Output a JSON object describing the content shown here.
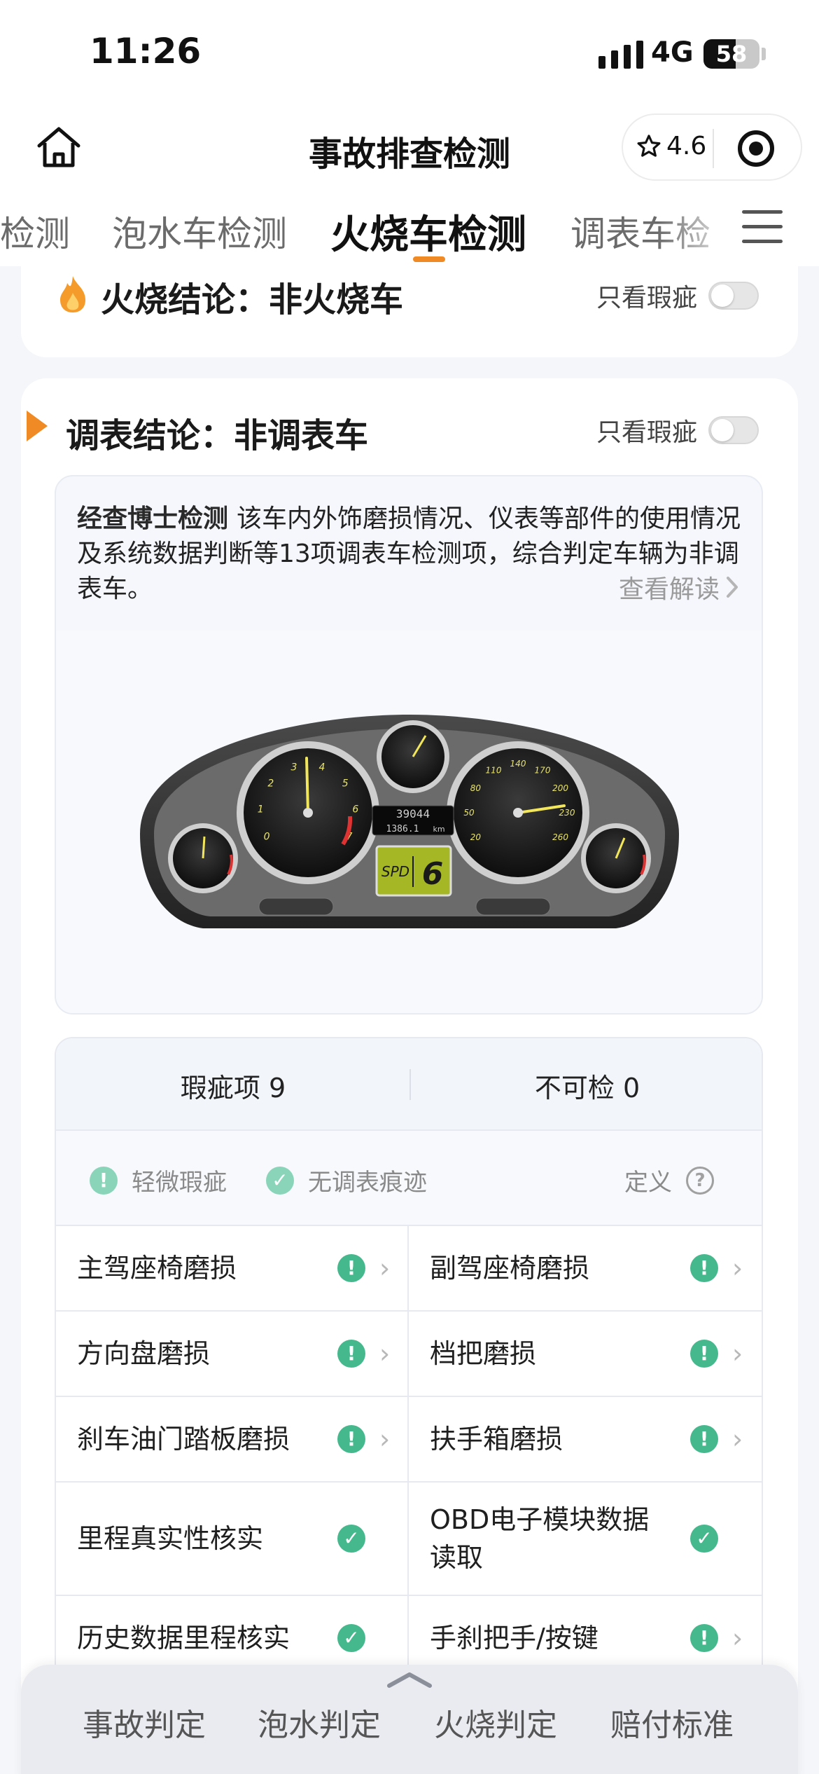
{
  "status_bar": {
    "time": "11:26",
    "network": "4G",
    "battery": "58",
    "battery_level": 0.58
  },
  "nav": {
    "title": "事故排查检测",
    "rating": "4.6"
  },
  "tabs": [
    {
      "label": "检测",
      "active": false
    },
    {
      "label": "泡水车检测",
      "active": false
    },
    {
      "label": "火烧车检测",
      "active": true
    },
    {
      "label": "调表车检",
      "active": false
    }
  ],
  "fire_section": {
    "title": "火烧结论：非火烧车",
    "filter_label": "只看瑕疵"
  },
  "meter_section": {
    "title": "调表结论：非调表车",
    "filter_label": "只看瑕疵",
    "brand": "经查博士检测",
    "description": "该车内外饰磨损情况、仪表等部件的使用情况及系统数据判断等13项调表车检测项，综合判定车辆为非调表车。",
    "read_more": "查看解读",
    "dashboard": {
      "odometer": "39044",
      "trip": "1386.1",
      "odo_unit": "km",
      "spd_label": "SPD",
      "gear": "6",
      "tacho_ticks": [
        "0",
        "1",
        "2",
        "3",
        "4",
        "5",
        "6",
        "7"
      ],
      "speed_ticks": [
        "20",
        "50",
        "80",
        "110",
        "140",
        "170",
        "200",
        "230",
        "260"
      ]
    }
  },
  "summary": {
    "flaws_label": "瑕疵项",
    "flaws_count": "9",
    "uncheckable_label": "不可检",
    "uncheckable_count": "0"
  },
  "legend": {
    "minor": "轻微瑕疵",
    "clean": "无调表痕迹",
    "definition": "定义"
  },
  "check_items": [
    [
      {
        "label": "主驾座椅磨损",
        "status": "warn",
        "chevron": true
      },
      {
        "label": "副驾座椅磨损",
        "status": "warn",
        "chevron": true
      }
    ],
    [
      {
        "label": "方向盘磨损",
        "status": "warn",
        "chevron": true
      },
      {
        "label": "档把磨损",
        "status": "warn",
        "chevron": true
      }
    ],
    [
      {
        "label": "刹车油门踏板磨损",
        "status": "warn",
        "chevron": true
      },
      {
        "label": "扶手箱磨损",
        "status": "warn",
        "chevron": true
      }
    ],
    [
      {
        "label": "里程真实性核实",
        "status": "ok",
        "chevron": false
      },
      {
        "label": "OBD电子模块数据读取",
        "status": "ok",
        "chevron": false
      }
    ],
    [
      {
        "label": "历史数据里程核实",
        "status": "ok",
        "chevron": false
      },
      {
        "label": "手刹把手/按键",
        "status": "warn",
        "chevron": true
      }
    ]
  ],
  "bottom_tabs": [
    "事故判定",
    "泡水判定",
    "火烧判定",
    "赔付标准"
  ],
  "colors": {
    "accent": "#f08a25",
    "status_green": "#45b88d"
  },
  "icons": {
    "home": "home-icon",
    "star": "star-icon",
    "target": "target-icon",
    "menu": "menu-icon",
    "fire": "fire-icon",
    "chevron": "chevron-right-icon",
    "help": "question-icon"
  }
}
